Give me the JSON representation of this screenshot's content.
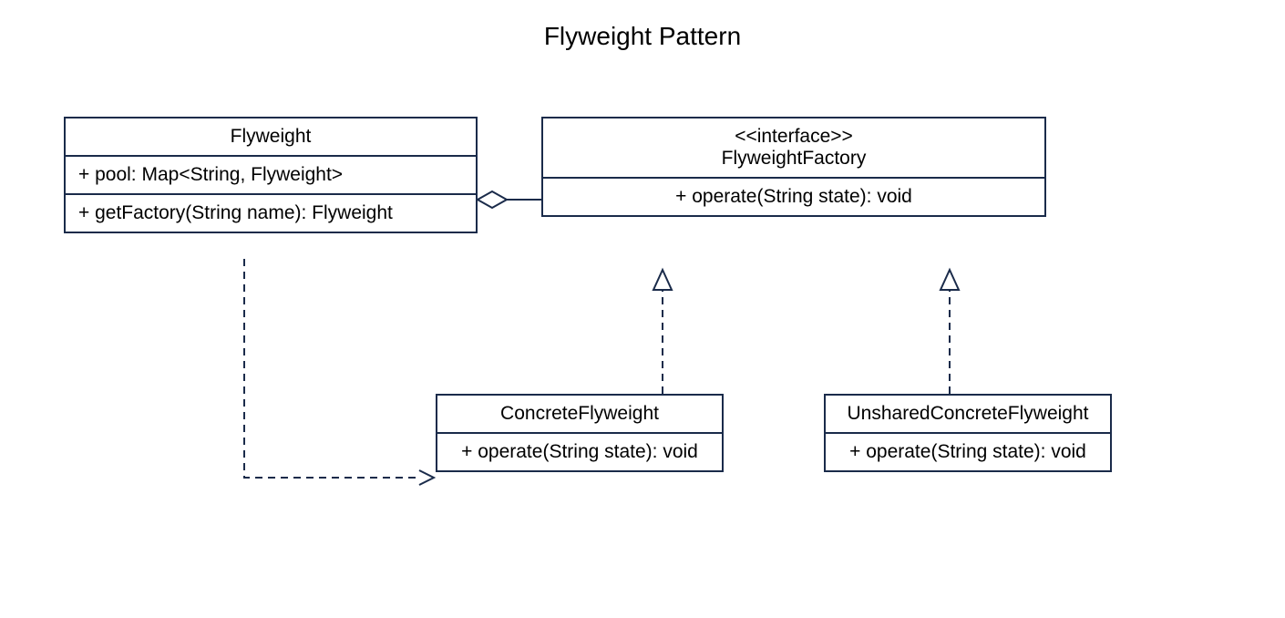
{
  "title": "Flyweight Pattern",
  "classes": {
    "flyweight": {
      "name": "Flyweight",
      "attribute": "+   pool:  Map<String, Flyweight>",
      "operation": "+   getFactory(String name): Flyweight"
    },
    "factory": {
      "stereotype": "<<interface>>",
      "name": "FlyweightFactory",
      "operation": "+   operate(String state): void"
    },
    "concrete": {
      "name": "ConcreteFlyweight",
      "operation": "+   operate(String state): void"
    },
    "unshared": {
      "name": "UnsharedConcreteFlyweight",
      "operation": "+   operate(String state): void"
    }
  }
}
